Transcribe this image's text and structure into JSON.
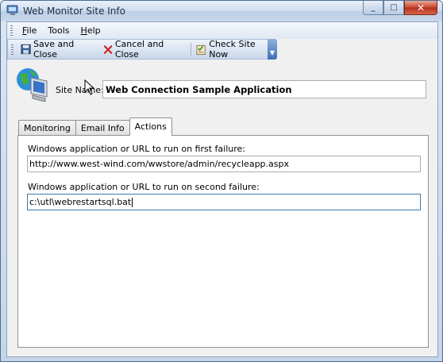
{
  "window": {
    "title": "Web Monitor Site Info"
  },
  "menu": {
    "items": [
      {
        "label": "File",
        "accel": "F",
        "rest": "ile"
      },
      {
        "label": "Tools"
      },
      {
        "label": "Help",
        "accel": "H",
        "rest": "elp"
      }
    ]
  },
  "toolbar": {
    "save_label": "Save and Close",
    "cancel_label": "Cancel and Close",
    "check_label": "Check Site Now"
  },
  "site": {
    "label": "Site Name:",
    "value": "Web Connection Sample Application"
  },
  "tabs": [
    {
      "label": "Monitoring",
      "active": false
    },
    {
      "label": "Email Info",
      "active": false
    },
    {
      "label": "Actions",
      "active": true
    }
  ],
  "actions": {
    "first_label": "Windows application or URL to run on first failure:",
    "first_value": "http://www.west-wind.com/wwstore/admin/recycleapp.aspx",
    "second_label": "Windows application or URL to run on second failure:",
    "second_value": "c:\\utl\\webrestartsql.bat"
  },
  "colors": {
    "accent": "#3e6fb5",
    "close": "#c8442c"
  }
}
